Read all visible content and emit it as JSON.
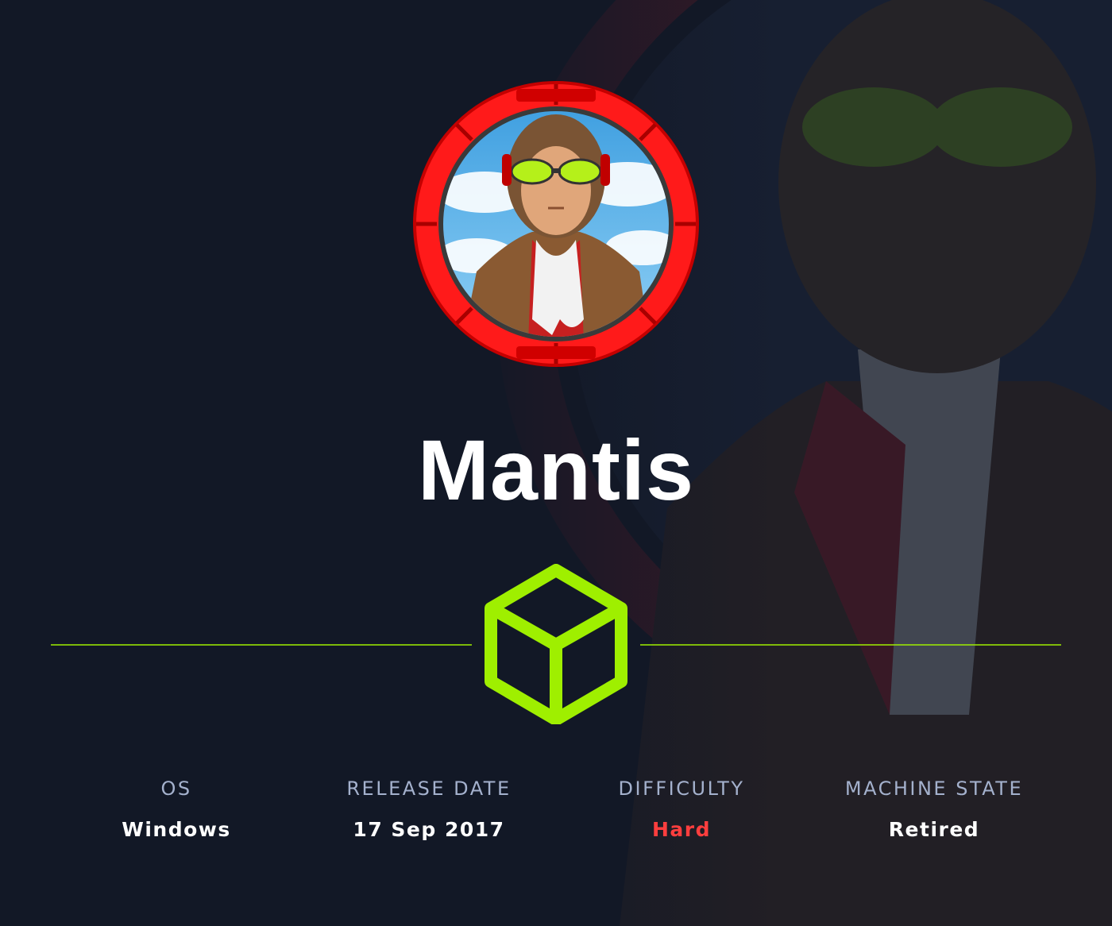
{
  "machine": {
    "name": "Mantis",
    "avatar_icon": "aviator-avatar-icon",
    "platform_icon": "hackthebox-cube-icon"
  },
  "colors": {
    "background": "#121826",
    "accent_green": "#9fef00",
    "difficulty_hard": "#ff3e3e",
    "label": "#a4b1cd",
    "avatar_ring": "#ff1a1a"
  },
  "stats": {
    "os": {
      "label": "OS",
      "value": "Windows"
    },
    "release": {
      "label": "RELEASE DATE",
      "value": "17 Sep 2017"
    },
    "difficulty": {
      "label": "DIFFICULTY",
      "value": "Hard"
    },
    "state": {
      "label": "MACHINE STATE",
      "value": "Retired"
    }
  }
}
